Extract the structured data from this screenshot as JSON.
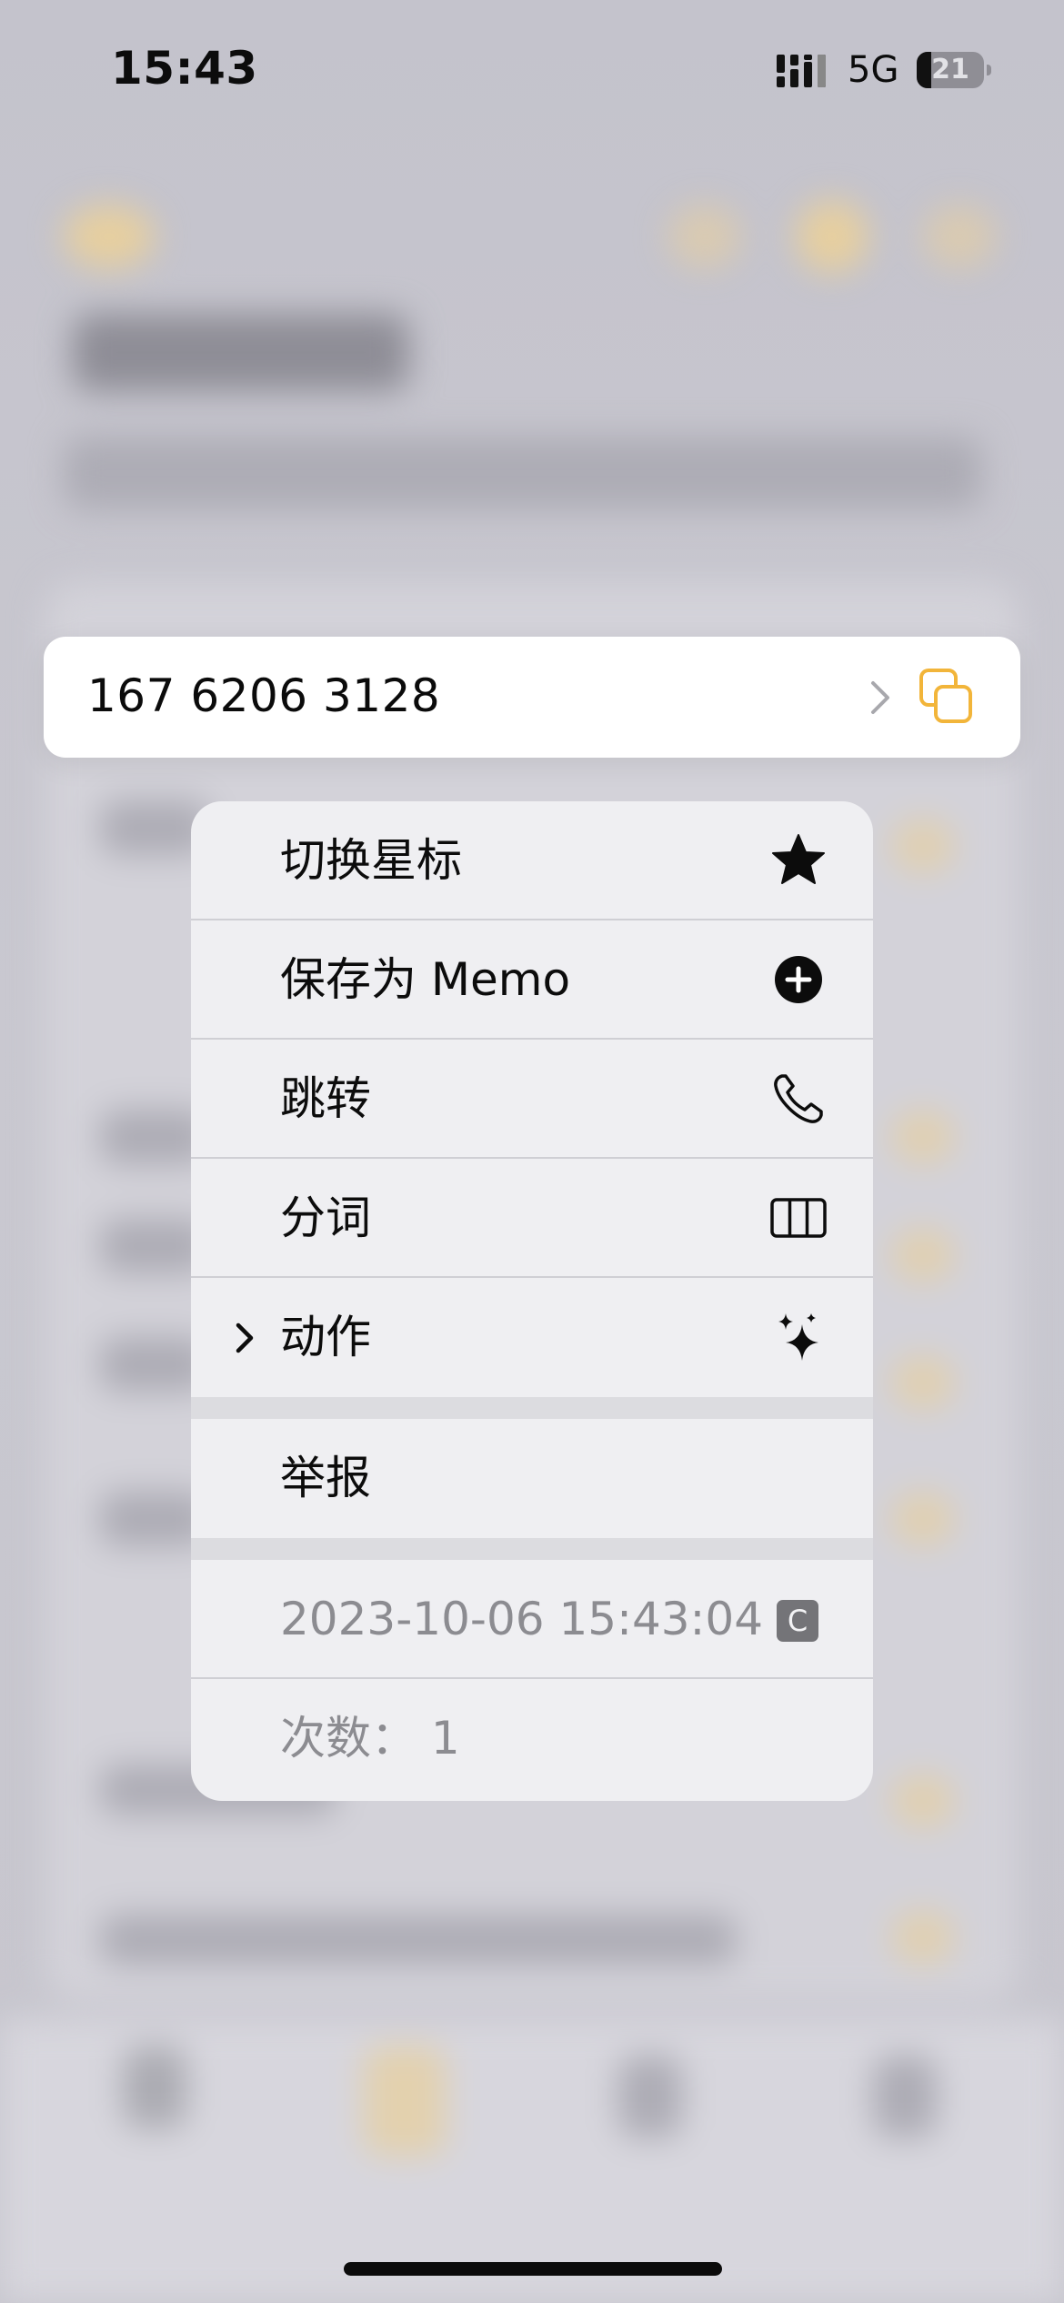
{
  "status_bar": {
    "time": "15:43",
    "network": "5G",
    "battery_level": "21",
    "battery_fraction": 0.21
  },
  "focus_row": {
    "phone_number": "167 6206 3128",
    "chevron_icon": "chevron-right-icon",
    "copy_icon": "copy-icon",
    "accent_color": "#f2b53a"
  },
  "menu": {
    "items": [
      {
        "label": "切换星标",
        "icon": "star-icon"
      },
      {
        "label": "保存为 Memo",
        "icon": "plus-circle-icon"
      },
      {
        "label": "跳转",
        "icon": "phone-icon"
      },
      {
        "label": "分词",
        "icon": "columns-icon"
      },
      {
        "label": "动作",
        "icon": "sparkles-icon",
        "has_submenu": true
      }
    ],
    "report_label": "举报",
    "timestamp": "2023-10-06 15:43:04",
    "timestamp_badge": "C",
    "count_label": "次数： 1"
  }
}
